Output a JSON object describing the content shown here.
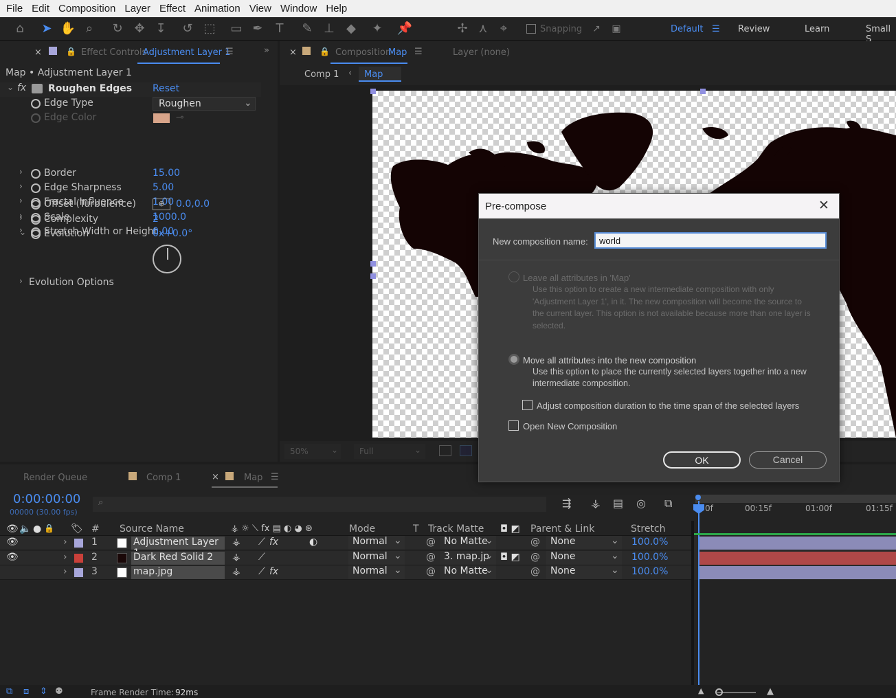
{
  "menu": [
    "File",
    "Edit",
    "Composition",
    "Layer",
    "Effect",
    "Animation",
    "View",
    "Window",
    "Help"
  ],
  "toolbar": {
    "snapping": "Snapping",
    "workspaces": [
      "Default",
      "Review",
      "Learn",
      "Small S"
    ]
  },
  "effect_panel": {
    "tab_prefix": "Effect Controls",
    "tab_layer": "Adjustment Layer 1",
    "breadcrumb": "Map • Adjustment Layer 1",
    "effect_name": "Roughen Edges",
    "reset": "Reset",
    "edge_type_label": "Edge Type",
    "edge_type_value": "Roughen",
    "edge_color_label": "Edge Color",
    "edge_color_value": "#d9a58a",
    "props": [
      {
        "name": "Border",
        "value": "15.00"
      },
      {
        "name": "Edge Sharpness",
        "value": "5.00"
      },
      {
        "name": "Fractal Influence",
        "value": "1.00"
      },
      {
        "name": "Scale",
        "value": "1000.0"
      },
      {
        "name": "Stretch Width or Height",
        "value": "0.00"
      }
    ],
    "offset_label": "Offset (Turbulence)",
    "offset_value": "0.0,0.0",
    "complexity_label": "Complexity",
    "complexity_value": "2",
    "evolution_label": "Evolution",
    "evolution_value": "0x+0.0°",
    "evolution_options": "Evolution Options"
  },
  "comp_panel": {
    "tab_prefix": "Composition",
    "tab_name": "Map",
    "layer_tab": "Layer (none)",
    "breadcrumb_1": "Comp 1",
    "breadcrumb_2": "Map",
    "zoom": "50%",
    "resolution": "Full"
  },
  "dialog": {
    "title": "Pre-compose",
    "name_label": "New composition name:",
    "name_value": "world",
    "opt1_label": "Leave all attributes in 'Map'",
    "opt1_desc": "Use this option to create a new intermediate composition with only 'Adjustment Layer 1', in it. The new composition will become the source to the current layer. This option is not available because more than one layer is selected.",
    "opt2_label": "Move all attributes into the new composition",
    "opt2_desc": "Use this option to place the currently selected layers together into a new intermediate composition.",
    "adjust_label": "Adjust composition duration to the time span of the selected layers",
    "open_label": "Open New Composition",
    "ok": "OK",
    "cancel": "Cancel"
  },
  "timeline": {
    "tabs": [
      "Render Queue",
      "Comp 1",
      "Map"
    ],
    "timecode": "0:00:00:00",
    "frames": "00000 (30.00 fps)",
    "headers": {
      "num": "#",
      "source": "Source Name",
      "mode": "Mode",
      "t": "T",
      "matte": "Track Matte",
      "parent": "Parent & Link",
      "stretch": "Stretch"
    },
    "ruler": [
      "0f",
      "00:15f",
      "01:00f",
      "01:15f"
    ],
    "layers": [
      {
        "num": "1",
        "name": "Adjustment Layer 1",
        "color": "#a7a6da",
        "swatch": "#ffffff",
        "mode": "Normal",
        "matte": "No Matte",
        "parent": "None",
        "stretch": "100.0%",
        "bar": "#8b8bb8"
      },
      {
        "num": "2",
        "name": "Dark Red Solid 2",
        "color": "#c9403a",
        "swatch": "#1a0808",
        "mode": "Normal",
        "matte": "3. map.jp",
        "parent": "None",
        "stretch": "100.0%",
        "bar": "#b04848"
      },
      {
        "num": "3",
        "name": "map.jpg",
        "color": "#a7a6da",
        "swatch": "#ffffff",
        "mode": "Normal",
        "matte": "No Matte",
        "parent": "None",
        "stretch": "100.0%",
        "bar": "#8b8bb8"
      }
    ],
    "render_time_label": "Frame Render Time:",
    "render_time": "92ms"
  }
}
